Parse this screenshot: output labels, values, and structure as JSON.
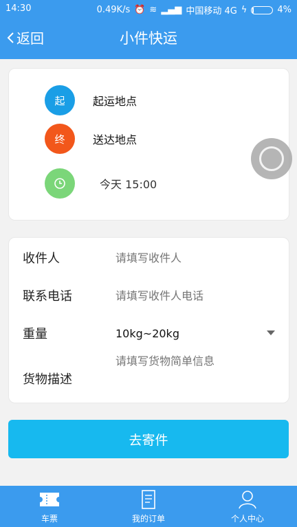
{
  "status_bar": {
    "time": "14:30",
    "speed": "0.49K/s",
    "carrier": "中国移动 4G",
    "battery": "4%"
  },
  "header": {
    "back_label": "返回",
    "title": "小件快运"
  },
  "route": {
    "start_badge": "起",
    "start_label": "起运地点",
    "end_badge": "终",
    "end_label": "送达地点",
    "time_label": "今天 15:00"
  },
  "form": {
    "recipient_label": "收件人",
    "recipient_placeholder": "请填写收件人",
    "phone_label": "联系电话",
    "phone_placeholder": "请填写收件人电话",
    "weight_label": "重量",
    "weight_value": "10kg~20kg",
    "desc_label": "货物描述",
    "desc_placeholder": "请填写货物简单信息"
  },
  "submit_label": "去寄件",
  "tabs": [
    {
      "label": "车票",
      "icon": "ticket-icon"
    },
    {
      "label": "我的订单",
      "icon": "orders-icon"
    },
    {
      "label": "个人中心",
      "icon": "profile-icon"
    }
  ],
  "colors": {
    "primary": "#3b9bee",
    "start": "#1a9ee6",
    "end": "#f2571b",
    "time": "#7bd679",
    "button": "#17b9ef"
  }
}
